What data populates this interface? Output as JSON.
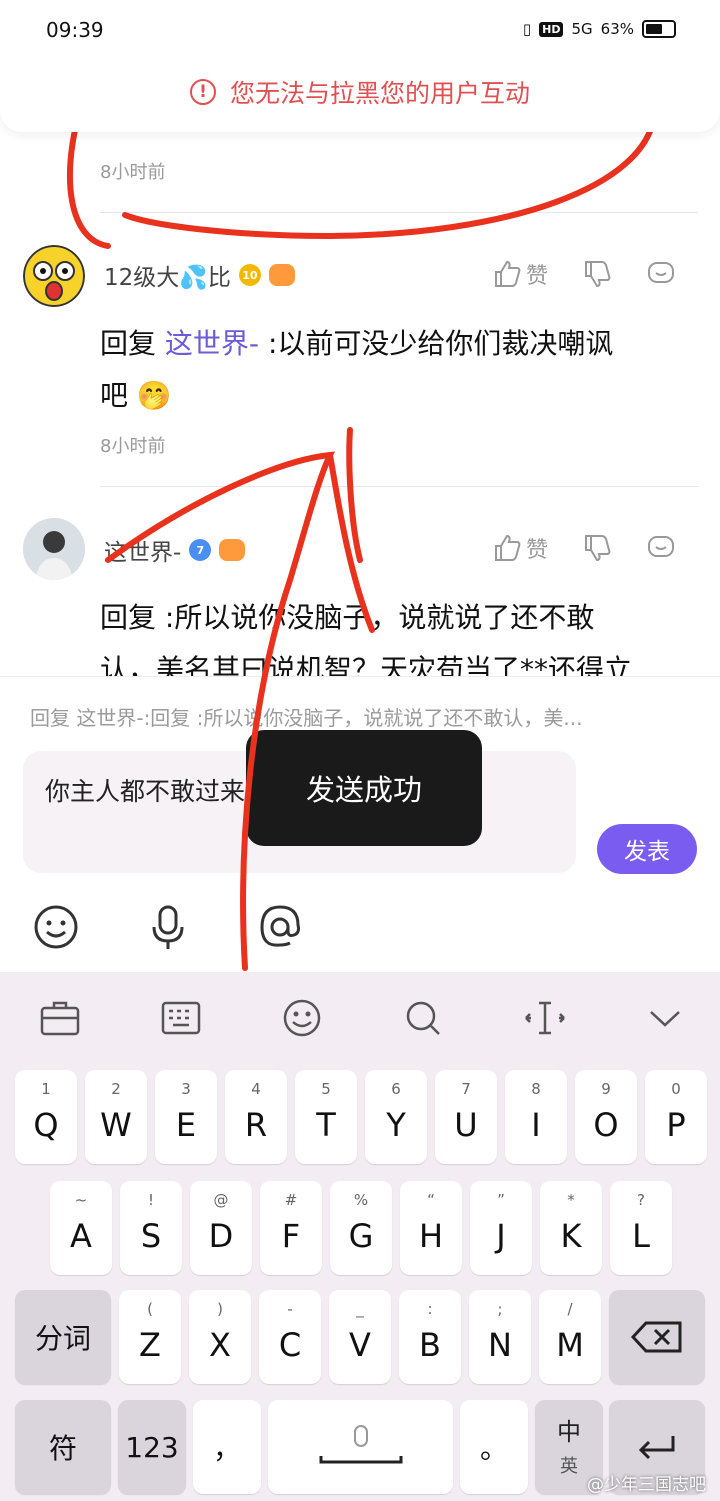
{
  "status": {
    "time": "09:39",
    "network": "5G",
    "battery": "63%",
    "hd": "HD"
  },
  "banner": {
    "text": "您无法与拉黑您的用户互动",
    "icon": "warning-circle-icon"
  },
  "comments": [
    {
      "time_ago": "8小时前"
    },
    {
      "username": "12级大💦比",
      "level": "10",
      "reply_prefix": "回复",
      "mention": "这世界-",
      "text_line1": ":以前可没少给你们裁决嘲讽",
      "text_line2": "吧 🤭",
      "time_ago": "8小时前",
      "like_label": "赞"
    },
    {
      "username": "这世界-",
      "level": "7",
      "reply_prefix": "回复",
      "text_line1": ":所以说你没脑子，说就说了还不敢",
      "text_line2": "认，美名其曰说机智？天灾苟当了**还得立",
      "like_label": "赞"
    }
  ],
  "composer": {
    "quote": "回复 这世界-:回复 :所以说你没脑子，说就说了还不敢认，美...",
    "input_text": "你主人都不敢过来，你在这里卖忠诚😝",
    "send_label": "发表"
  },
  "toast": "发送成功",
  "keyboard": {
    "row1": [
      {
        "n": "1",
        "c": "Q"
      },
      {
        "n": "2",
        "c": "W"
      },
      {
        "n": "3",
        "c": "E"
      },
      {
        "n": "4",
        "c": "R"
      },
      {
        "n": "5",
        "c": "T"
      },
      {
        "n": "6",
        "c": "Y"
      },
      {
        "n": "7",
        "c": "U"
      },
      {
        "n": "8",
        "c": "I"
      },
      {
        "n": "9",
        "c": "O"
      },
      {
        "n": "0",
        "c": "P"
      }
    ],
    "row2": [
      {
        "n": "~",
        "c": "A"
      },
      {
        "n": "!",
        "c": "S"
      },
      {
        "n": "@",
        "c": "D"
      },
      {
        "n": "#",
        "c": "F"
      },
      {
        "n": "%",
        "c": "G"
      },
      {
        "n": "“",
        "c": "H"
      },
      {
        "n": "”",
        "c": "J"
      },
      {
        "n": "*",
        "c": "K"
      },
      {
        "n": "?",
        "c": "L"
      }
    ],
    "row3_left": "分词",
    "row3": [
      {
        "n": "(",
        "c": "Z"
      },
      {
        "n": ")",
        "c": "X"
      },
      {
        "n": "-",
        "c": "C"
      },
      {
        "n": "_",
        "c": "V"
      },
      {
        "n": ":",
        "c": "B"
      },
      {
        "n": ";",
        "c": "N"
      },
      {
        "n": "/",
        "c": "M"
      }
    ],
    "sym": "符",
    "num": "123",
    "comma": "，",
    "period": "。",
    "lang_top": "中",
    "lang_bottom": "英"
  },
  "watermark": "@少年三国志吧",
  "colors": {
    "accent": "#7a5cf0",
    "warning": "#e05050",
    "annotation": "#e8321e"
  }
}
